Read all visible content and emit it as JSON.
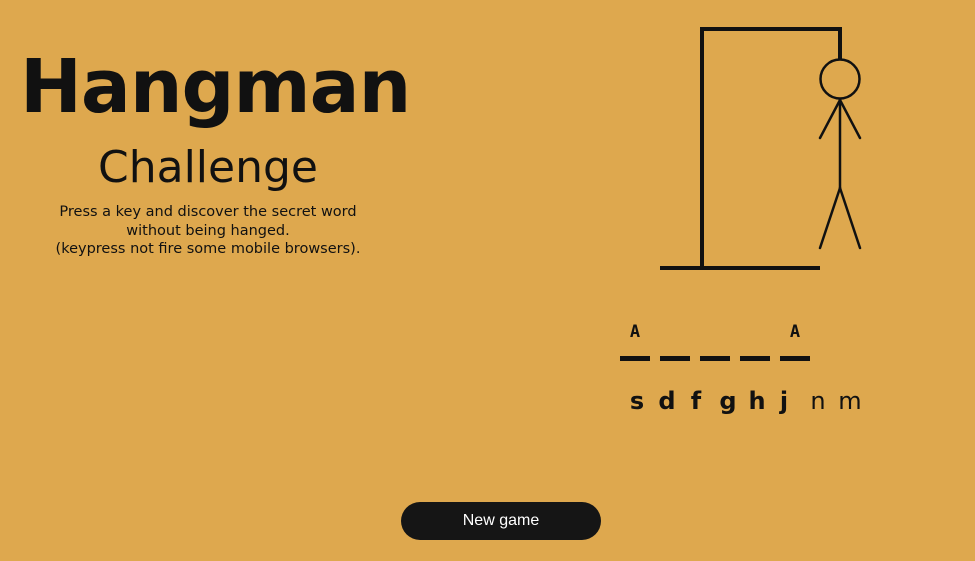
{
  "header": {
    "title": "Hangman",
    "subtitle": "Challenge",
    "instructions": [
      "Press a key and discover the secret word",
      "without being hanged.",
      "(keypress not fire some mobile browsers)."
    ]
  },
  "hangman": {
    "parts_shown": [
      "base",
      "pole",
      "beam",
      "rope",
      "head",
      "body",
      "left-arm",
      "right-arm",
      "left-leg",
      "right-leg"
    ]
  },
  "word": {
    "slots": [
      "A",
      "",
      "",
      "",
      "A"
    ]
  },
  "guessed_letters": [
    {
      "letter": "s",
      "state": "wrong"
    },
    {
      "letter": "d",
      "state": "wrong"
    },
    {
      "letter": "f",
      "state": "wrong"
    },
    {
      "letter": "g",
      "state": "wrong"
    },
    {
      "letter": "h",
      "state": "wrong"
    },
    {
      "letter": "j",
      "state": "wrong"
    },
    {
      "letter": "n",
      "state": "right"
    },
    {
      "letter": "m",
      "state": "right"
    }
  ],
  "actions": {
    "new_game_label": "New game"
  },
  "colors": {
    "background": "#dea84e",
    "ink": "#111111",
    "button_bg": "#151515",
    "button_text": "#ffffff"
  }
}
